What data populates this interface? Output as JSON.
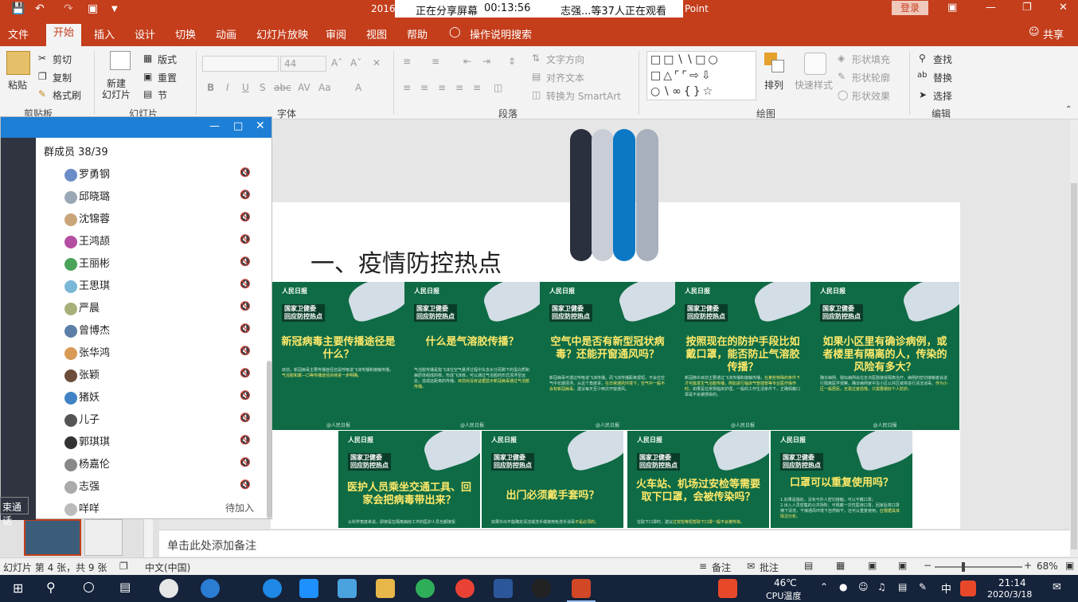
{
  "titlebar": {
    "title_fragment_left": "2016",
    "title_fragment_right": "Point",
    "login": "登录"
  },
  "share_banner": {
    "status": "正在分享屏幕",
    "timer": "00:13:56",
    "viewers": "志强...等37人正在观看"
  },
  "menu": {
    "items": [
      "文件",
      "开始",
      "插入",
      "设计",
      "切换",
      "动画",
      "幻灯片放映",
      "审阅",
      "视图",
      "帮助",
      "操作说明搜索"
    ],
    "share": "共享"
  },
  "ribbon": {
    "clipboard": {
      "paste": "粘贴",
      "cut": "剪切",
      "copy": "复制",
      "format_painter": "格式刷",
      "group": "剪贴板"
    },
    "slides": {
      "new_slide": "新建\n幻灯片",
      "layout": "版式",
      "reset": "重置",
      "section": "节",
      "group": "幻灯片"
    },
    "font": {
      "size": "44",
      "group": "字体",
      "buttons": [
        "B",
        "I",
        "U",
        "S",
        "abc",
        "AV",
        "Aa",
        "A"
      ]
    },
    "paragraph": {
      "text_direction": "文字方向",
      "align_text": "对齐文本",
      "smartart": "转换为 SmartArt",
      "group": "段落"
    },
    "drawing": {
      "arrange": "排列",
      "quick_styles": "快速样式",
      "shape_fill": "形状填充",
      "shape_outline": "形状轮廓",
      "shape_effects": "形状效果",
      "group": "绘图"
    },
    "editing": {
      "find": "查找",
      "replace": "替换",
      "select": "选择",
      "group": "编辑"
    }
  },
  "slide": {
    "title": "一、疫情防控热点",
    "posters": [
      {
        "logo": "人民日报",
        "header": "国家卫健委\n回应防控热点",
        "question": "新冠病毒主要传播途径是什么？",
        "body": "目前，新冠病毒主要传播途径还是呼吸道飞沫传播和接触传播，",
        "highlight": "气溶胶和粪—口等传播途径尚待进一步明确。"
      },
      {
        "logo": "人民日报",
        "header": "国家卫健委\n回应防控热点",
        "question": "什么是气溶胶传播？",
        "body": "气溶胶传播是指飞沫在空气悬浮过程中失去水分而剩下的蛋白质和病原体组成的核，形成飞沫核，可以通过气溶胶的形式漂浮至远处，造成远距离的传播。",
        "highlight": "目前尚没有证据显示新冠病毒通过气溶胶传播。"
      },
      {
        "logo": "人民日报",
        "header": "国家卫健委\n回应防控热点",
        "question": "空气中是否有新型冠状病毒？还能开窗通风吗？",
        "body": "新冠病毒可通过呼吸道飞沫传播，而飞沫传播距离很短，不会在空气中长期漂浮。从这个角度讲，",
        "highlight": "在日常通风环境下，空气中一般不会有新冠病毒。",
        "body2": "建议每天至少两次开窗通风。"
      },
      {
        "logo": "人民日报",
        "header": "国家卫健委\n回应防控热点",
        "question": "按照现在的防护手段比如戴口罩，能否防止气溶胶传播？",
        "body": "新冠肺炎目前主要通过飞沫传播和接触传播，",
        "highlight": "在某些特殊的条件下才可能发生气溶胶传播，例如进行临床气管插管等专业医疗操作时。",
        "body2": "如果是在常规临床护理，一般的工作生活条件下，正确佩戴口罩是不会被感染的。"
      },
      {
        "logo": "人民日报",
        "header": "国家卫健委\n回应防控热点",
        "question": "如果小区里有确诊病例，或者楼里有隔离的人，传染的风险有多大？",
        "body": "确诊病例、疑似病例会在定点医院接受隔离治疗，病例的密切接触者会进行隔离医学观察，确诊病例家中及小区公共区域将进行清洁消毒，",
        "highlight": "作为小区一般居民，无需过度恐慌，只需要做好个人防护。"
      },
      {
        "logo": "人民日报",
        "header": "国家卫健委\n回应防控热点",
        "question": "医护人员乘坐交通工具、回家会把病毒带出来？",
        "body": "从科学角度来说，即使是在隔离病房工作的医护人员也都接受"
      },
      {
        "logo": "人民日报",
        "header": "国家卫健委\n回应防控热点",
        "question": "出门必须戴手套吗？",
        "highlight": "不是必须的。",
        "body": "如果外出不能确定清洁或洗手或使用免洗手消毒"
      },
      {
        "logo": "人民日报",
        "header": "国家卫健委\n回应防控热点",
        "question": "火车站、机场过安检等需要取下口罩，会被传染吗？",
        "highlight": "过安检等短暂取下口罩一般不会被传染。",
        "body": "在取下口罩时，建议"
      },
      {
        "logo": "人民日报",
        "header": "国家卫健委\n回应防控热点",
        "question": "口罩可以重复使用吗？",
        "highlight": "应根据具体情况分析。",
        "body": "1.如果是独处，没有与外人密切接触，可以不戴口罩；\n2.出入人员密集的公共场所，可佩戴一次性医用口罩，回家后将口罩摘下清洗，干燥通风环境下自然晾干，还可以重复使用。"
      }
    ],
    "poster_footer": "@人民日报"
  },
  "notes_placeholder": "单击此处添加备注",
  "chat": {
    "member_count": "群成员 38/39",
    "members": [
      {
        "name": "罗勇钢",
        "color": "#6a8cc7"
      },
      {
        "name": "邱晓璐",
        "color": "#9aa7b5"
      },
      {
        "name": "沈锦蓉",
        "color": "#c9a67a"
      },
      {
        "name": "王鸿颉",
        "color": "#b44ea0"
      },
      {
        "name": "王丽彬",
        "color": "#4ba35a"
      },
      {
        "name": "王思琪",
        "color": "#7ab8d8"
      },
      {
        "name": "严晨",
        "color": "#a7b07a"
      },
      {
        "name": "曾博杰",
        "color": "#5b7fa6"
      },
      {
        "name": "张华鸿",
        "color": "#d99a55"
      },
      {
        "name": "张颖",
        "color": "#6b4d3a"
      },
      {
        "name": "猪妖",
        "color": "#3f83c4"
      },
      {
        "name": "儿子",
        "color": "#555555"
      },
      {
        "name": "郭琪琪",
        "color": "#333333"
      },
      {
        "name": "杨嘉伦",
        "color": "#888888"
      },
      {
        "name": "志强",
        "color": "#aaaaaa"
      },
      {
        "name": "咩咩",
        "color": "#bbbbbb",
        "status": "待加入"
      }
    ],
    "call_label": "束通话"
  },
  "statusbar": {
    "slide_info": "幻灯片 第 4 张，共 9 张",
    "language": "中文(中国)",
    "notes": "备注",
    "comments": "批注",
    "zoom": "68%"
  },
  "taskbar": {
    "temperature": "46℃",
    "cpu_label": "CPU温度",
    "ime": "中",
    "time": "21:14",
    "date": "2020/3/18"
  },
  "decor_bars": [
    "#2a303d",
    "#c9ced6",
    "#0a78c4",
    "#a9b0bd"
  ]
}
